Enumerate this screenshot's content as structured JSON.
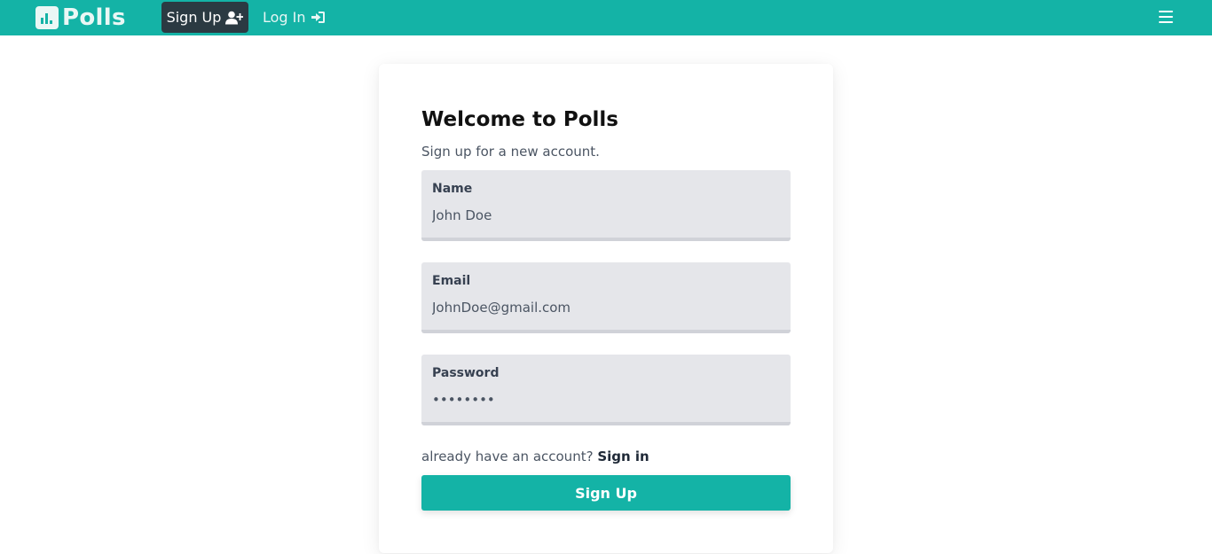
{
  "nav": {
    "brand": "Polls",
    "signup_label": "Sign Up",
    "login_label": "Log In"
  },
  "form": {
    "title": "Welcome to Polls",
    "subtitle": "Sign up for a new account.",
    "name_label": "Name",
    "name_value": "John Doe",
    "email_label": "Email",
    "email_value": "JohnDoe@gmail.com",
    "password_label": "Password",
    "password_value": "password",
    "account_prompt": "already have an account?",
    "signin_link": "Sign in",
    "submit_label": "Sign Up"
  },
  "icons": {
    "brand": "bar-chart-icon",
    "signup": "user-plus-icon",
    "login": "sign-in-icon",
    "menu": "hamburger-menu-icon"
  },
  "colors": {
    "primary": "#14b3a6",
    "dark": "#2b3a42",
    "field_bg": "#e5e6ea"
  }
}
